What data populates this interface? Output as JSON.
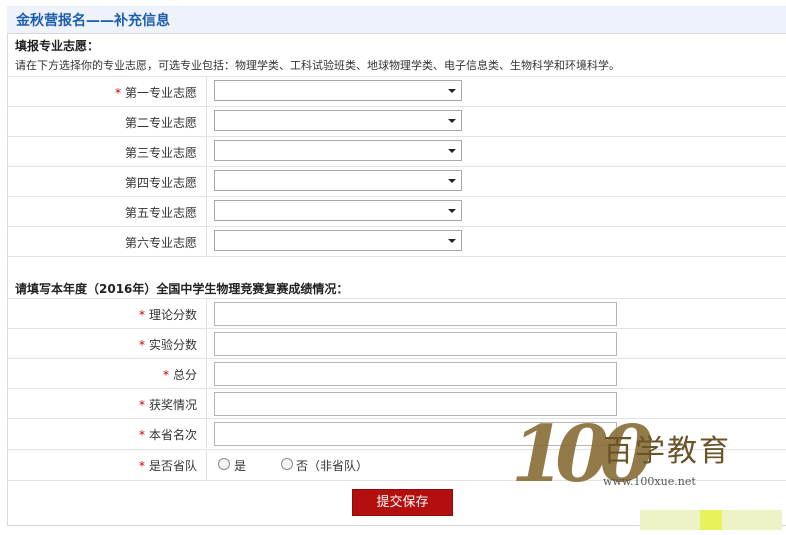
{
  "title": "金秋营报名——补充信息",
  "section1": {
    "heading": "填报专业志愿：",
    "desc": "请在下方选择你的专业志愿，可选专业包括：物理学类、工科试验班类、地球物理学类、电子信息类、生物科学和环境科学。",
    "rows": [
      {
        "label": "第一专业志愿",
        "required": true,
        "value": ""
      },
      {
        "label": "第二专业志愿",
        "required": false,
        "value": ""
      },
      {
        "label": "第三专业志愿",
        "required": false,
        "value": ""
      },
      {
        "label": "第四专业志愿",
        "required": false,
        "value": ""
      },
      {
        "label": "第五专业志愿",
        "required": false,
        "value": ""
      },
      {
        "label": "第六专业志愿",
        "required": false,
        "value": ""
      }
    ]
  },
  "section2": {
    "heading": "请填写本年度（2016年）全国中学生物理竞赛复赛成绩情况：",
    "rows": [
      {
        "label": "理论分数",
        "required": true,
        "value": ""
      },
      {
        "label": "实验分数",
        "required": true,
        "value": ""
      },
      {
        "label": "总分",
        "required": true,
        "value": ""
      },
      {
        "label": "获奖情况",
        "required": true,
        "value": ""
      },
      {
        "label": "本省名次",
        "required": true,
        "value": ""
      }
    ],
    "province_team": {
      "label": "是否省队",
      "required": true,
      "options": [
        "是",
        "否（非省队）"
      ]
    }
  },
  "required_mark": "*",
  "submit_label": "提交保存",
  "watermark": {
    "number": "100",
    "brand": "百学教育",
    "url": "www.100xue.net"
  },
  "colors": {
    "title": "#1d5fae",
    "title_bg": "#eef2fa",
    "required": "#d00000",
    "submit_bg": "#b40f0f",
    "watermark": "#8a6f3a"
  }
}
